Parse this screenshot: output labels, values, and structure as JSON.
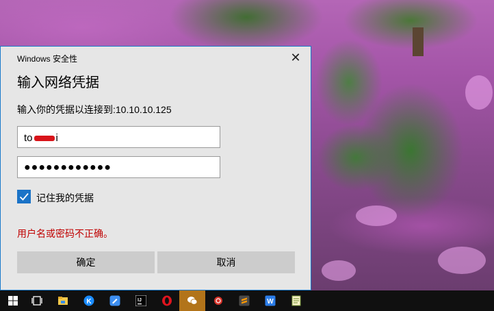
{
  "dialog": {
    "window_title": "Windows 安全性",
    "heading": "输入网络凭据",
    "prompt": "输入你的凭据以连接到:10.10.10.125",
    "username_prefix": "to",
    "username_suffix": "i",
    "password_mask": "●●●●●●●●●●●●",
    "remember_label": "记住我的凭据",
    "remember_checked": true,
    "error": "用户名或密码不正确。",
    "ok_label": "确定",
    "cancel_label": "取消",
    "close_icon": "✕"
  },
  "taskbar": {
    "items": [
      {
        "name": "start",
        "icon": "windows-logo-icon"
      },
      {
        "name": "task-view",
        "icon": "task-view-icon"
      },
      {
        "name": "file-explorer",
        "icon": "folder-icon"
      },
      {
        "name": "kugou",
        "icon": "k-circle-icon"
      },
      {
        "name": "feishu",
        "icon": "pen-chat-icon"
      },
      {
        "name": "intellij",
        "icon": "ij-icon"
      },
      {
        "name": "opera",
        "icon": "opera-icon"
      },
      {
        "name": "wechat",
        "icon": "wechat-icon",
        "active": true
      },
      {
        "name": "snail-app",
        "icon": "snail-icon"
      },
      {
        "name": "sublime-text",
        "icon": "sublime-icon"
      },
      {
        "name": "wps-writer",
        "icon": "w-icon"
      },
      {
        "name": "notepad",
        "icon": "notepad-icon"
      }
    ]
  },
  "colors": {
    "accent": "#1a73c7",
    "error": "#c00000",
    "taskbar_active": "#b2741a"
  }
}
